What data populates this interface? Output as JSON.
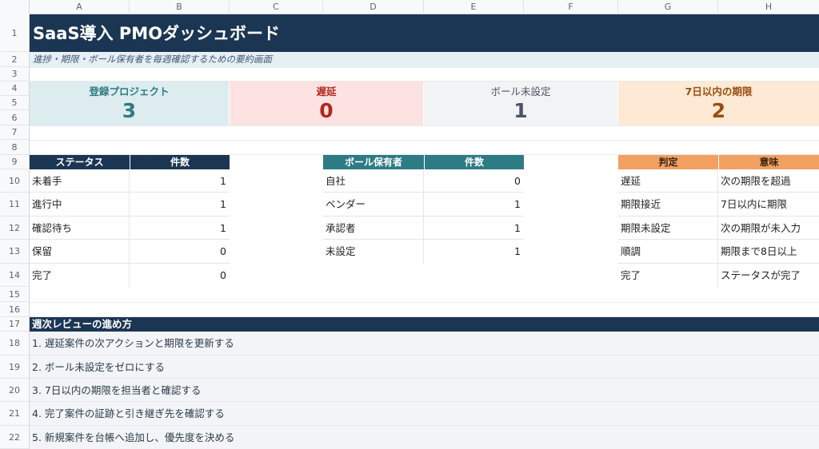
{
  "columns": [
    "A",
    "B",
    "C",
    "D",
    "E",
    "F",
    "G",
    "H"
  ],
  "rows": [
    "1",
    "2",
    "3",
    "4",
    "5",
    "6",
    "7",
    "8",
    "9",
    "10",
    "11",
    "12",
    "13",
    "14",
    "15",
    "16",
    "17",
    "18",
    "19",
    "20",
    "21",
    "22"
  ],
  "title": "SaaS導入 PMOダッシュボード",
  "subtitle": "進捗・期限・ボール保有者を毎週確認するための要約画面",
  "kpis": [
    {
      "label": "登録プロジェクト",
      "value": "3",
      "color": "#2f7a83",
      "bg": "#dcecef"
    },
    {
      "label": "遅延",
      "value": "0",
      "color": "#b3261e",
      "bg": "#fde2e2"
    },
    {
      "label": "ボール未設定",
      "value": "1",
      "color": "#4a5563",
      "bg": "#f1f3f5"
    },
    {
      "label": "7日以内の期限",
      "value": "2",
      "color": "#9a4d0f",
      "bg": "#fde9d4"
    }
  ],
  "status_table": {
    "headers": [
      "ステータス",
      "件数"
    ],
    "header_bg": "#1b3653",
    "rows": [
      {
        "name": "未着手",
        "count": "1"
      },
      {
        "name": "進行中",
        "count": "1"
      },
      {
        "name": "確認待ち",
        "count": "1"
      },
      {
        "name": "保留",
        "count": "0"
      },
      {
        "name": "完了",
        "count": "0"
      }
    ]
  },
  "owner_table": {
    "headers": [
      "ボール保有者",
      "件数"
    ],
    "header_bg": "#2d7b84",
    "rows": [
      {
        "name": "自社",
        "count": "0"
      },
      {
        "name": "ベンダー",
        "count": "1"
      },
      {
        "name": "承認者",
        "count": "1"
      },
      {
        "name": "未設定",
        "count": "1"
      }
    ]
  },
  "legend_table": {
    "headers": [
      "判定",
      "意味"
    ],
    "header_bg": "#f2a062",
    "header_color": "#3a2410",
    "rows": [
      {
        "judge": "遅延",
        "meaning": "次の期限を超過"
      },
      {
        "judge": "期限接近",
        "meaning": "7日以内に期限"
      },
      {
        "judge": "期限未設定",
        "meaning": "次の期限が未入力"
      },
      {
        "judge": "順調",
        "meaning": "期限まで8日以上"
      },
      {
        "judge": "完了",
        "meaning": "ステータスが完了"
      }
    ]
  },
  "review": {
    "heading": "週次レビューの進め方",
    "steps": [
      "1. 遅延案件の次アクションと期限を更新する",
      "2. ボール未設定をゼロにする",
      "3. 7日以内の期限を担当者と確認する",
      "4. 完了案件の証跡と引き継ぎ先を確認する",
      "5. 新規案件を台帳へ追加し、優先度を決める"
    ]
  }
}
